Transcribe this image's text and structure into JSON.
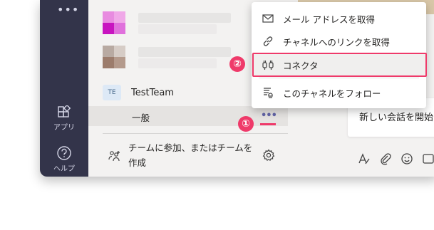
{
  "rail": {
    "more_label": "•••",
    "apps_label": "アプリ",
    "help_label": "ヘルプ"
  },
  "channels": {
    "team_initials": "TE",
    "team_name": "TestTeam",
    "channel_name": "一般",
    "more_options": "•••",
    "join_text": "チームに参加、またはチームを作成"
  },
  "chat": {
    "compose_placeholder": "新しい会話を開始"
  },
  "menu": {
    "items": [
      {
        "label": "メール アドレスを取得",
        "icon": "mail-icon"
      },
      {
        "label": "チャネルへのリンクを取得",
        "icon": "link-icon"
      },
      {
        "label": "コネクタ",
        "icon": "connector-icon"
      },
      {
        "label": "このチャネルをフォロー",
        "icon": "follow-icon"
      }
    ]
  },
  "callouts": {
    "step1": "①",
    "step2": "②"
  },
  "colors": {
    "rail_bg": "#33344a",
    "accent": "#6264a7",
    "annotation": "#ef3a6a"
  }
}
